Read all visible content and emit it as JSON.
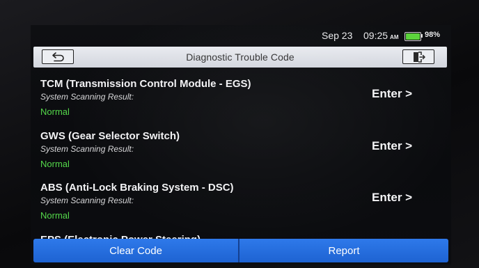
{
  "status_bar": {
    "date": "Sep 23",
    "time": "09:25",
    "ampm": "AM",
    "battery_percent": "98%",
    "battery_level": 0.98,
    "battery_color": "#5cd43c"
  },
  "title_bar": {
    "title": "Diagnostic Trouble Code",
    "back_icon": "back-arrow-icon",
    "exit_icon": "exit-door-icon"
  },
  "systems": [
    {
      "name": "TCM (Transmission Control Module - EGS)",
      "result_label": "System Scanning Result:",
      "status": "Normal",
      "action": "Enter >"
    },
    {
      "name": "GWS (Gear Selector Switch)",
      "result_label": "System Scanning Result:",
      "status": "Normal",
      "action": "Enter >"
    },
    {
      "name": "ABS (Anti-Lock Braking System - DSC)",
      "result_label": "System Scanning Result:",
      "status": "Normal",
      "action": "Enter >"
    },
    {
      "name": "EPS (Electronic Power Steering)"
    }
  ],
  "buttons": {
    "clear_code": "Clear Code",
    "report": "Report"
  },
  "colors": {
    "status_normal": "#54d84a",
    "button_blue": "#2a72e4",
    "title_bar": "#e0e2e8"
  }
}
